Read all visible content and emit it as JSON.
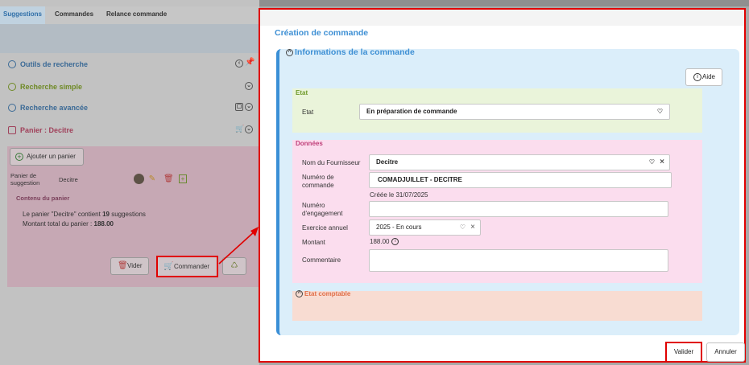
{
  "tabs": [
    "Suggestions",
    "Commandes",
    "Relance commande"
  ],
  "sidebar": {
    "items": [
      {
        "label": "Outils de recherche",
        "color": "#3b6a96",
        "icon": "clock-icon"
      },
      {
        "label": "Recherche simple",
        "color": "#6f8a26",
        "icon": "search-icon"
      },
      {
        "label": "Recherche avancée",
        "color": "#3b6a96",
        "icon": "search-icon"
      },
      {
        "label": "Panier : Decitre",
        "color": "#a0405a",
        "icon": "cart-icon"
      }
    ]
  },
  "cart": {
    "add_label": "Ajouter un panier",
    "panier_label": "Panier de suggestion",
    "panier_value": "Decitre",
    "contenu_title": "Contenu du panier",
    "line1_prefix": "Le panier \"Decitre\" contient ",
    "line1_count": "19",
    "line1_suffix": " suggestions",
    "line2_prefix": "Montant total du panier : ",
    "line2_amount": "188.00",
    "vider_label": "Vider",
    "commander_label": "Commander"
  },
  "modal": {
    "title": "Création de commande",
    "info_title": "Informations de la commande",
    "aide_label": "Aide",
    "etat_section": "Etat",
    "etat_label": "Etat",
    "etat_value": "En préparation de commande",
    "donnees_section": "Données",
    "fournisseur_label": "Nom du Fournisseur",
    "fournisseur_value": "Decitre",
    "numero_commande_label": "Numéro de commande",
    "numero_commande_value": "COMADJUILLET - DECITRE",
    "creee_note": "Créée le 31/07/2025",
    "engagement_label": "Numéro d'engagement",
    "engagement_value": "",
    "exercice_label": "Exercice annuel",
    "exercice_value": "2025 - En cours",
    "montant_label": "Montant",
    "montant_value": "188.00",
    "commentaire_label": "Commentaire",
    "commentaire_value": "",
    "comptable_section": "Etat comptable",
    "valider_label": "Valider",
    "annuler_label": "Annuler"
  },
  "colors": {
    "accent": "#3d8fd4",
    "highlight": "#e00000"
  }
}
